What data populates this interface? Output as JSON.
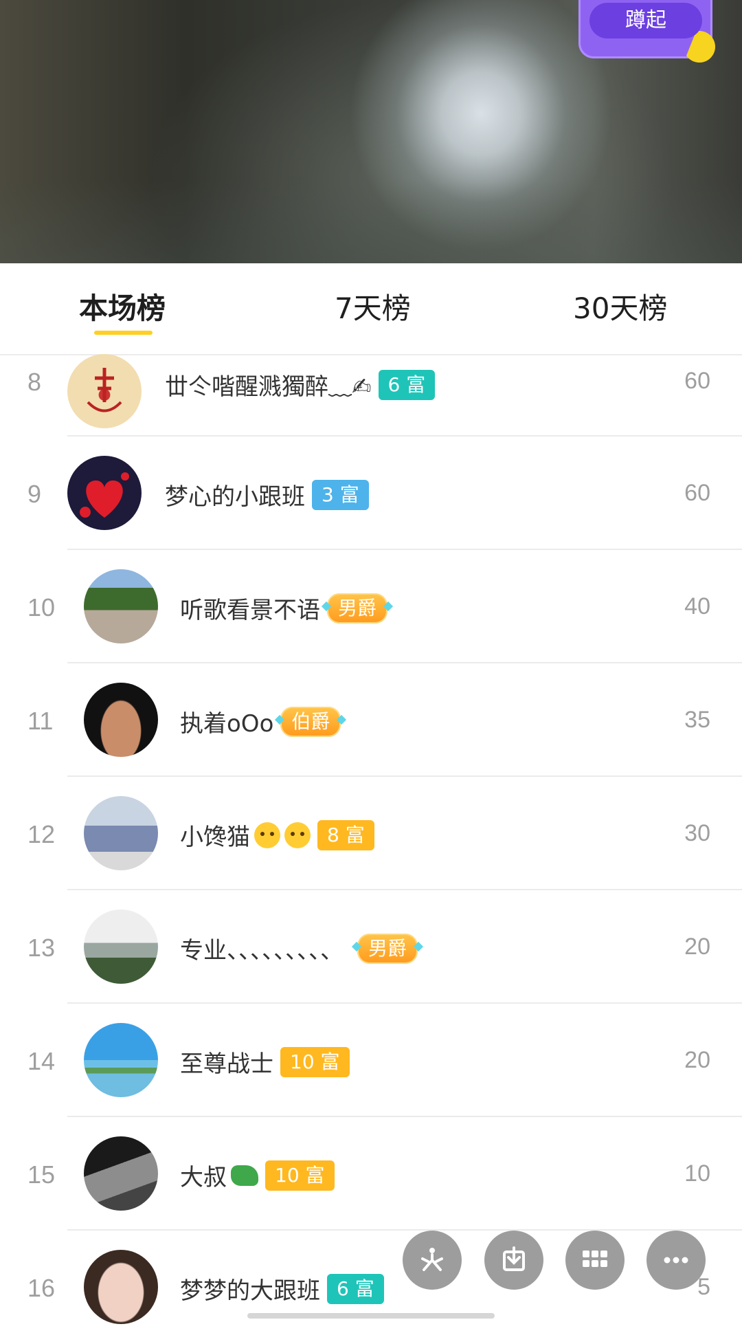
{
  "squat_button": {
    "label": "蹲起"
  },
  "tabs": [
    {
      "label": "本场榜",
      "active": true
    },
    {
      "label": "7天榜",
      "active": false
    },
    {
      "label": "30天榜",
      "active": false
    }
  ],
  "leaderboard": [
    {
      "rank": "8",
      "name": "丗仒喈醒溅獨醉﹏✍",
      "badge": "6 富",
      "badge_style": "teal",
      "score": "60"
    },
    {
      "rank": "9",
      "name": "梦心的小跟班",
      "badge": "3 富",
      "badge_style": "blue",
      "score": "60"
    },
    {
      "rank": "10",
      "name": "听歌看景不语",
      "badge": "男爵",
      "badge_style": "noble",
      "score": "40"
    },
    {
      "rank": "11",
      "name": "执着oOo",
      "badge": "伯爵",
      "badge_style": "noble",
      "score": "35"
    },
    {
      "rank": "12",
      "name": "小馋猫",
      "badge": "8 富",
      "badge_style": "gold",
      "score": "30"
    },
    {
      "rank": "13",
      "name": "专业、、、、、、、、、",
      "badge": "男爵",
      "badge_style": "noble",
      "score": "20"
    },
    {
      "rank": "14",
      "name": "至尊战士",
      "badge": "10 富",
      "badge_style": "gold",
      "score": "20"
    },
    {
      "rank": "15",
      "name": "大叔",
      "badge": "10 富",
      "badge_style": "gold",
      "score": "10"
    },
    {
      "rank": "16",
      "name": "梦梦的大跟班",
      "badge": "6 富",
      "badge_style": "teal",
      "score": "5"
    }
  ],
  "fab_buttons": [
    "share-icon",
    "download-icon",
    "grid-icon",
    "more-icon"
  ],
  "colors": {
    "accent": "#ffcf22",
    "badge_teal": "#1fc4b8",
    "badge_blue": "#4db3ea",
    "badge_gold": "#ffb81f",
    "purple": "#8f63f2"
  }
}
